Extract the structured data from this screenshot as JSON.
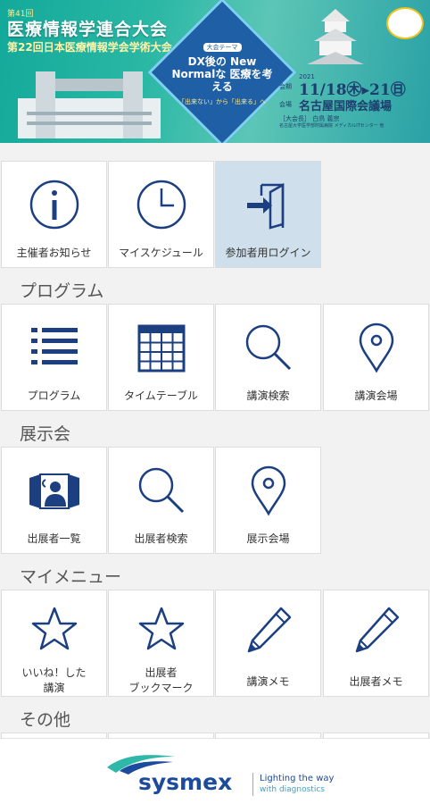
{
  "banner": {
    "congress_no": "第41回",
    "title": "医療情報学連合大会",
    "subtitle": "第22回日本医療情報学会学術大会",
    "theme_label": "大会テーマ",
    "theme_main": "DX後の New Normalな 医療を考える",
    "theme_sub": "「出来ない」から「出来る」へ",
    "year": "2021",
    "date_prefix": "会期",
    "dates": "11/18㊍▸21㊐",
    "venue_prefix": "会場",
    "venue": "名古屋国際会議場",
    "organizer": "［大会長］ 白鳥 義宗",
    "organizer_affiliation": "名古屋大学医学部附属病院 メディカルITセンター 他"
  },
  "tiles_top": [
    {
      "label": "主催者お知らせ",
      "icon": "info-icon"
    },
    {
      "label": "マイスケジュール",
      "icon": "clock-icon"
    },
    {
      "label": "参加者用ログイン",
      "icon": "login-icon"
    }
  ],
  "sections": {
    "program": "プログラム",
    "exhibition": "展示会",
    "mymenu": "マイメニュー",
    "other": "その他"
  },
  "tiles_program": [
    {
      "label": "プログラム",
      "icon": "list-icon"
    },
    {
      "label": "タイムテーブル",
      "icon": "calendar-grid-icon"
    },
    {
      "label": "講演検索",
      "icon": "search-icon"
    },
    {
      "label": "講演会場",
      "icon": "map-pin-icon"
    }
  ],
  "tiles_exhibition": [
    {
      "label": "出展者一覧",
      "icon": "exhibitor-booth-icon"
    },
    {
      "label": "出展者検索",
      "icon": "search-icon"
    },
    {
      "label": "展示会場",
      "icon": "map-pin-icon"
    }
  ],
  "tiles_mymenu": [
    {
      "label": "いいね！した講演",
      "line1": "いいね！した",
      "line2": "講演",
      "icon": "star-icon"
    },
    {
      "label": "出展者ブックマーク",
      "line1": "出展者",
      "line2": "ブックマーク",
      "icon": "star-icon"
    },
    {
      "label": "講演メモ",
      "icon": "pencil-icon"
    },
    {
      "label": "出展者メモ",
      "icon": "pencil-icon"
    }
  ],
  "footer": {
    "brand": "sysmex",
    "tagline1": "Lighting the way",
    "tagline2": "with diagnostics"
  },
  "colors": {
    "icon_blue": "#1c3f82",
    "active_tile": "#cfe0ec",
    "banner_teal": "#2bb8a5"
  }
}
